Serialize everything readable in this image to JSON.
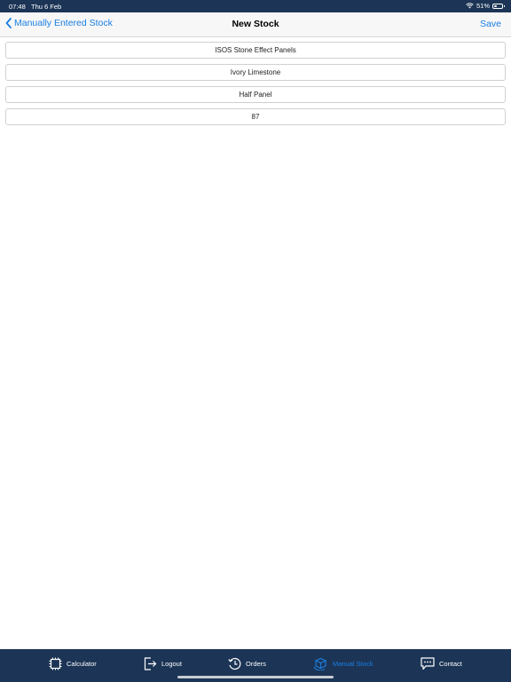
{
  "status_bar": {
    "time": "07:48",
    "date": "Thu 6 Feb",
    "battery_percent": "51%",
    "battery_level": 0.51,
    "wifi_icon": "wifi-icon",
    "battery_icon": "battery-icon"
  },
  "nav_bar": {
    "back_label": "Manually Entered Stock",
    "title": "New Stock",
    "save_label": "Save"
  },
  "fields": [
    {
      "value": "ISOS Stone Effect Panels"
    },
    {
      "value": "Ivory Limestone"
    },
    {
      "value": "Half Panel"
    },
    {
      "value": "87"
    }
  ],
  "tab_bar": {
    "tabs": [
      {
        "label": "Calculator",
        "icon": "calculator-icon"
      },
      {
        "label": "Logout",
        "icon": "logout-icon"
      },
      {
        "label": "Orders",
        "icon": "orders-history-icon"
      },
      {
        "label": "Manual Stock",
        "icon": "manual-stock-icon",
        "active": true
      },
      {
        "label": "Contact",
        "icon": "contact-chat-icon"
      }
    ]
  },
  "colors": {
    "accent": "#1a7ee3",
    "bar_background": "#1c3556",
    "nav_background": "#f7f7f7"
  }
}
